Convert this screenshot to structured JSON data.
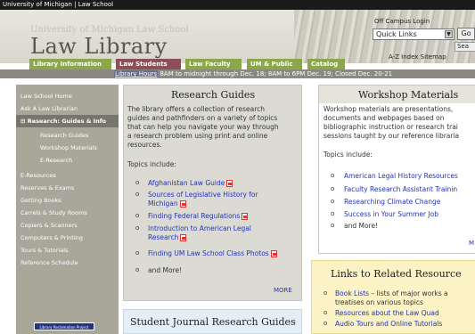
{
  "top_strip": "University of Michigan | Law School",
  "header": {
    "univ_line": "University of Michigan Law School",
    "title": "Law Library",
    "office_campus_login": "Off Campus Login",
    "quick_links": "Quick Links",
    "go": "Go",
    "search": "Sea",
    "index_sitemap": "A-Z Index    Sitemap"
  },
  "tabs": [
    {
      "label": "Library Information",
      "color": "#8aa84a"
    },
    {
      "label": "Law Students",
      "color": "#8b4f5a"
    },
    {
      "label": "Law Faculty",
      "color": "#8aa84a"
    },
    {
      "label": "UM & Public",
      "color": "#8aa84a"
    },
    {
      "label": "Catalog",
      "color": "#8aa84a"
    }
  ],
  "hours": {
    "label": "Library Hours",
    "text": "8AM to midnight through Dec. 18; 8AM to 6PM Dec. 19; Closed Dec. 20-21"
  },
  "sidebar": {
    "items": [
      {
        "label": "Law School Home"
      },
      {
        "label": "Ask A Law Librarian"
      },
      {
        "label": "Research: Guides & Info"
      },
      {
        "label": "Research Guides"
      },
      {
        "label": "Workshop Materials"
      },
      {
        "label": "E-Research"
      },
      {
        "label": "E-Resources"
      },
      {
        "label": "Reserves & Exams"
      },
      {
        "label": "Getting Books"
      },
      {
        "label": "Carrels & Study Rooms"
      },
      {
        "label": "Copiers & Scanners"
      },
      {
        "label": "Computers & Printing"
      },
      {
        "label": "Tours & Tutorials"
      },
      {
        "label": "Reference Schedule"
      }
    ],
    "badge": "Library Reclamation Project"
  },
  "research_guides": {
    "title": "Research Guides",
    "desc": [
      "The library offers a collection of research",
      "guides and pathfinders on a variety of topics",
      "that can help you navigate your way through",
      "a research problem using print and online",
      "resources."
    ],
    "topics_label": "Topics include:",
    "links": [
      "Afghanistan Law Guide",
      "Sources of Legislative History for",
      "Michigan",
      "Finding Federal Regulations",
      "Introduction to American Legal",
      "Research",
      "Finding UM Law School Class Photos"
    ],
    "and_more": "and More!",
    "more": "MORE"
  },
  "workshop": {
    "title": "Workshop Materials",
    "desc": [
      "Workshop materials are presentations,",
      "documents and webpages based on",
      "bibliographic instruction or research trai",
      "sessions taught by our reference libraria"
    ],
    "topics_label": "Topics include:",
    "links": [
      "American Legal History Resources",
      "Faculty Research Assistant Trainin",
      "Researching Climate Change",
      "Success in Your Summer Job"
    ],
    "and_more": "and More!",
    "more": "M"
  },
  "student_journal": {
    "title": "Student Journal Research Guides"
  },
  "related": {
    "title": "Links to Related Resource",
    "items": [
      {
        "link": "Book Lists",
        "text": " – lists of major works a"
      },
      {
        "link": "",
        "text": "treatises on various topics"
      },
      {
        "link": "Resources about the Law Quad",
        "text": ""
      },
      {
        "link": "Audio Tours and Online Tutorials",
        "text": ""
      }
    ]
  }
}
